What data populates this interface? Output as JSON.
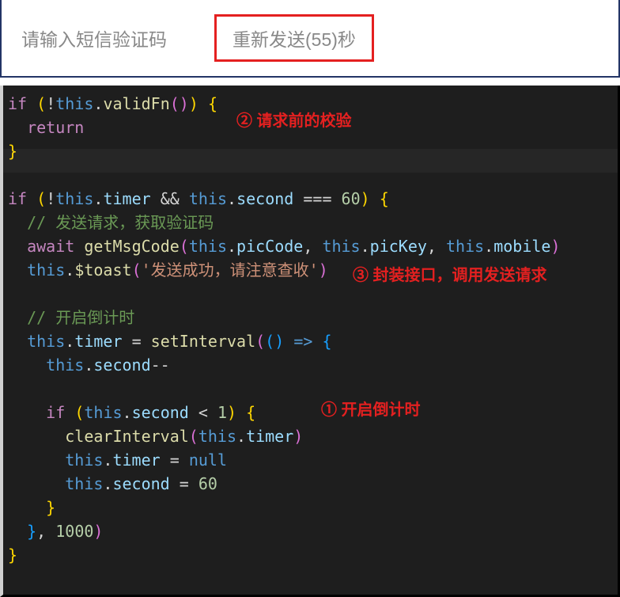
{
  "form": {
    "sms_placeholder": "请输入短信验证码",
    "resend_label": "重新发送(55)秒"
  },
  "annotations": {
    "a1": "① 开启倒计时",
    "a2": "② 请求前的校验",
    "a3": "③ 封装接口，调用发送请求"
  },
  "code": {
    "l1": {
      "if": "if",
      "this": "this",
      "validFn": "validFn",
      "paren": "()",
      "brace": "{",
      "bang": "(!",
      "dot": "."
    },
    "l2_return": "return",
    "l3_brace": "}",
    "l5": {
      "if": "if",
      "bang": "(!",
      "this": "this",
      "timer": "timer",
      "and": "&&",
      "second": "second",
      "eqeq": "===",
      "sixty": "60",
      "close": ")",
      "brace": "{",
      "dot": "."
    },
    "l6_comment": "// 发送请求，获取验证码",
    "l7": {
      "await": "await",
      "getMsgCode": "getMsgCode",
      "this": "this",
      "picCode": "picCode",
      "picKey": "picKey",
      "mobile": "mobile"
    },
    "l8": {
      "this": "this",
      "toast": "$toast",
      "msg": "'发送成功，请注意查收'"
    },
    "l10_comment": "// 开启倒计时",
    "l11": {
      "this": "this",
      "timer": "timer",
      "setInterval": "setInterval",
      "arrow": "=>"
    },
    "l12": {
      "this": "this",
      "second": "second",
      "dec": "--"
    },
    "l14": {
      "if": "if",
      "this": "this",
      "second": "second",
      "lt": "<",
      "one": "1"
    },
    "l15": {
      "clearInterval": "clearInterval",
      "this": "this",
      "timer": "timer"
    },
    "l16": {
      "this": "this",
      "timer": "timer",
      "null": "null"
    },
    "l17": {
      "this": "this",
      "second": "second",
      "sixty": "60"
    },
    "l18_brace": "}",
    "l19": {
      "brace": "}",
      "comma": ",",
      "thousand": "1000",
      "paren": ")"
    },
    "l20_brace": "}"
  }
}
